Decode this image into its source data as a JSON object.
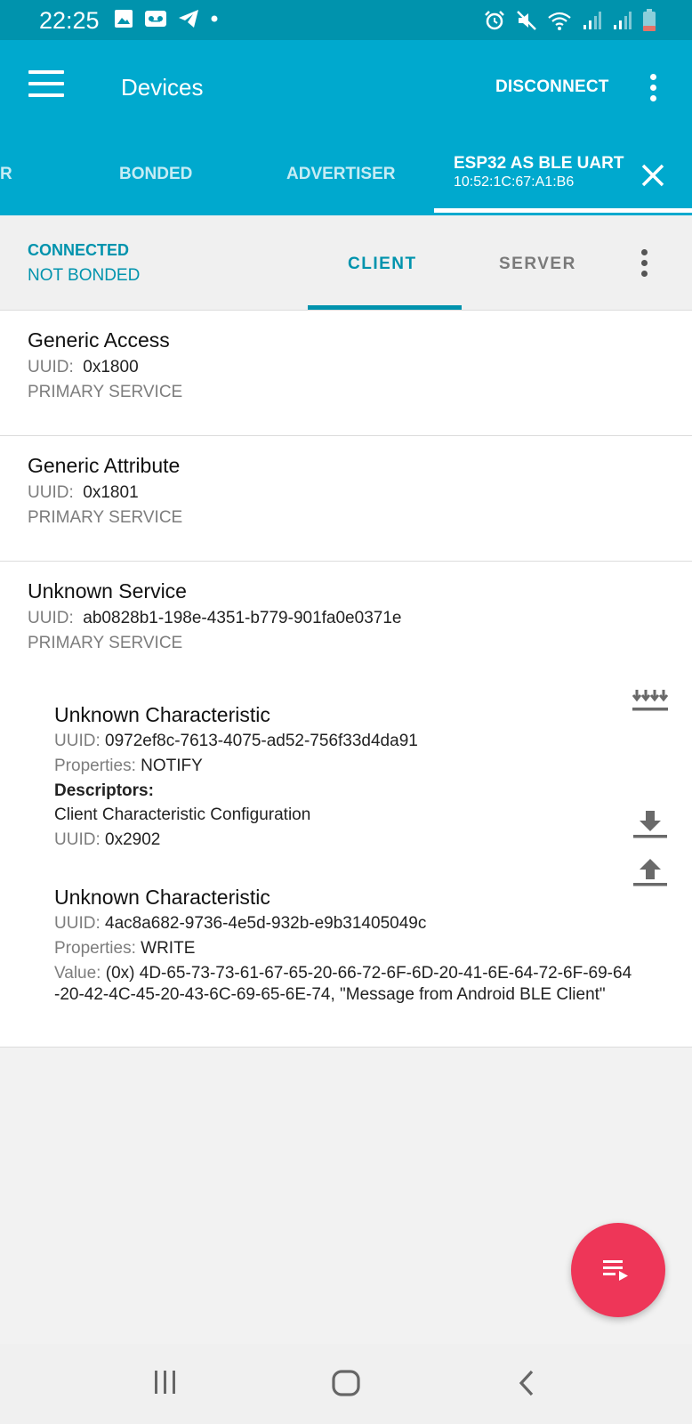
{
  "status_bar": {
    "time": "22:25",
    "left_icons": [
      "gallery-icon",
      "voicemail-icon",
      "telegram-icon",
      "notification-dot-icon"
    ],
    "right_icons": [
      "alarm-icon",
      "mute-icon",
      "wifi-icon",
      "signal-icon",
      "signal-icon",
      "battery-icon"
    ]
  },
  "app_bar": {
    "title": "Devices",
    "disconnect_label": "DISCONNECT",
    "background": "#00a9ce"
  },
  "device_tabs": {
    "partial_label": "R",
    "bonded_label": "BONDED",
    "advertiser_label": "ADVERTISER",
    "active": {
      "title": "ESP32 AS BLE UART",
      "address": "10:52:1C:67:A1:B6"
    }
  },
  "connection": {
    "state": "CONNECTED",
    "bond": "NOT BONDED",
    "tabs": {
      "client": "CLIENT",
      "server": "SERVER"
    },
    "selected_tab": "CLIENT",
    "accent": "#0093ad"
  },
  "labels": {
    "uuid": "UUID:",
    "properties": "Properties:",
    "value": "Value:",
    "descriptors": "Descriptors:"
  },
  "services": [
    {
      "name": "Generic Access",
      "uuid": "0x1800",
      "type": "PRIMARY SERVICE"
    },
    {
      "name": "Generic Attribute",
      "uuid": "0x1801",
      "type": "PRIMARY SERVICE"
    },
    {
      "name": "Unknown Service",
      "uuid": "ab0828b1-198e-4351-b779-901fa0e0371e",
      "type": "PRIMARY SERVICE",
      "characteristics": [
        {
          "name": "Unknown Characteristic",
          "uuid": "0972ef8c-7613-4075-ad52-756f33d4da91",
          "properties": "NOTIFY",
          "descriptor": {
            "name": "Client Characteristic Configuration",
            "uuid": "0x2902"
          }
        },
        {
          "name": "Unknown Characteristic",
          "uuid": "4ac8a682-9736-4e5d-932b-e9b31405049c",
          "properties": "WRITE",
          "value": "(0x) 4D-65-73-73-61-67-65-20-66-72-6F-6D-20-41-6E-64-72-6F-69-64-20-42-4C-45-20-43-6C-69-65-6E-74, \"Message from Android BLE Client\""
        }
      ]
    }
  ],
  "fab": {
    "icon": "log-playlist-icon",
    "color": "#ee3658"
  }
}
